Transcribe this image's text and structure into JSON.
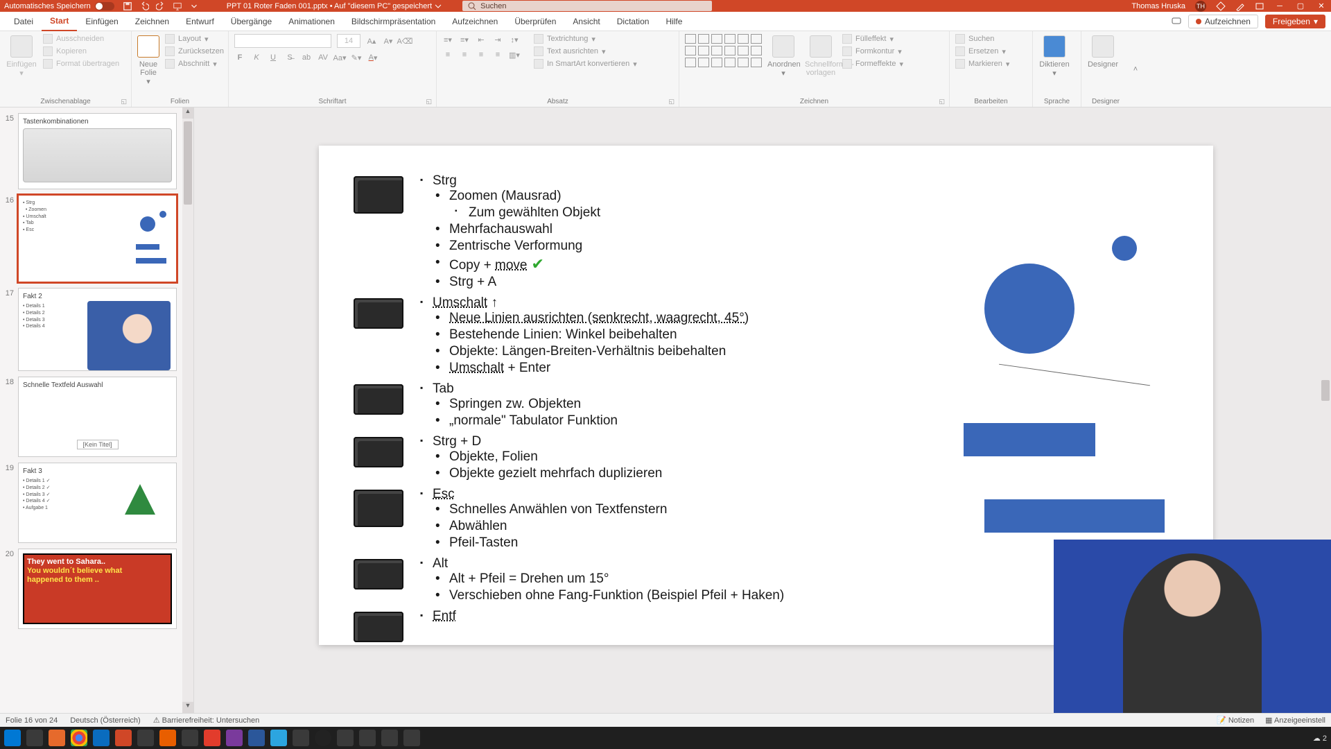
{
  "titlebar": {
    "autosave_label": "Automatisches Speichern",
    "filename": "PPT 01 Roter Faden 001.pptx • Auf \"diesem PC\" gespeichert",
    "search_placeholder": "Suchen",
    "user_name": "Thomas Hruska",
    "user_initials": "TH"
  },
  "tabs": {
    "file": "Datei",
    "home": "Start",
    "insert": "Einfügen",
    "draw": "Zeichnen",
    "design": "Entwurf",
    "transitions": "Übergänge",
    "animations": "Animationen",
    "slideshow": "Bildschirmpräsentation",
    "record": "Aufzeichnen",
    "review": "Überprüfen",
    "view": "Ansicht",
    "dictation": "Dictation",
    "help": "Hilfe",
    "record_btn": "Aufzeichnen",
    "share_btn": "Freigeben"
  },
  "ribbon": {
    "clipboard": {
      "label": "Zwischenablage",
      "paste": "Einfügen",
      "cut": "Ausschneiden",
      "copy": "Kopieren",
      "format_painter": "Format übertragen"
    },
    "slides": {
      "label": "Folien",
      "new_slide": "Neue Folie",
      "layout": "Layout",
      "reset": "Zurücksetzen",
      "section": "Abschnitt"
    },
    "font": {
      "label": "Schriftart",
      "size_value": "14"
    },
    "paragraph": {
      "label": "Absatz",
      "text_direction": "Textrichtung",
      "align_text": "Text ausrichten",
      "convert_smartart": "In SmartArt konvertieren"
    },
    "drawing": {
      "label": "Zeichnen",
      "arrange": "Anordnen",
      "quick_styles": "Schnellformat-vorlagen",
      "shape_fill": "Fülleffekt",
      "shape_outline": "Formkontur",
      "shape_effects": "Formeffekte"
    },
    "editing": {
      "label": "Bearbeiten",
      "find": "Suchen",
      "replace": "Ersetzen",
      "select": "Markieren"
    },
    "voice": {
      "label": "Sprache",
      "dictate": "Diktieren"
    },
    "designer": {
      "label": "Designer",
      "btn": "Designer"
    }
  },
  "thumbs": [
    {
      "num": "15",
      "title": "Tastenkombinationen"
    },
    {
      "num": "16",
      "title": ""
    },
    {
      "num": "17",
      "title": "Fakt 2"
    },
    {
      "num": "18",
      "title": "Schnelle Textfeld Auswahl",
      "notitle": "[Kein Titel]"
    },
    {
      "num": "19",
      "title": "Fakt 3"
    },
    {
      "num": "20",
      "title_line1": "They went to Sahara..",
      "title_line2": "You wouldn´t believe what",
      "title_line3": "happened to them .."
    }
  ],
  "slide": {
    "strg": {
      "h": "Strg",
      "zoom": "Zoomen (Mausrad)",
      "zoom_obj": "Zum gewählten Objekt",
      "multi": "Mehrfachauswahl",
      "zentr": "Zentrische Verformung",
      "copymove": "Copy + ",
      "copymove_u": "move",
      "strga": "Strg + A"
    },
    "umschalt": {
      "h": "Umschalt",
      "arrow": " ↑",
      "lines": "Neue Linien ausrichten (senkrecht, waagrecht, 45°)",
      "existing": "Bestehende Linien: Winkel beibehalten",
      "objects": "Objekte: Längen-Breiten-Verhältnis beibehalten",
      "enter": "Umschalt",
      "enter2": " + Enter"
    },
    "tab": {
      "h": "Tab",
      "jump": "Springen zw. Objekten",
      "normal": "„normale\" Tabulator Funktion"
    },
    "strgd": {
      "h": "Strg + D",
      "obj": "Objekte, Folien",
      "dup": "Objekte gezielt mehrfach duplizieren"
    },
    "esc": {
      "h": "Esc",
      "fast": "Schnelles Anwählen von Textfenstern",
      "deselect": "Abwählen",
      "arrows": "Pfeil-Tasten"
    },
    "alt": {
      "h": "Alt",
      "rotate": "Alt + Pfeil = Drehen um 15°",
      "move": "Verschieben ohne Fang-Funktion (Beispiel Pfeil + Haken)"
    },
    "entf": {
      "h": "Entf"
    }
  },
  "status": {
    "slide_of": "Folie 16 von 24",
    "language": "Deutsch (Österreich)",
    "accessibility": "Barrierefreiheit: Untersuchen",
    "notes": "Notizen",
    "display": "Anzeigeeinstell"
  },
  "taskbar": {
    "temp": "2"
  }
}
